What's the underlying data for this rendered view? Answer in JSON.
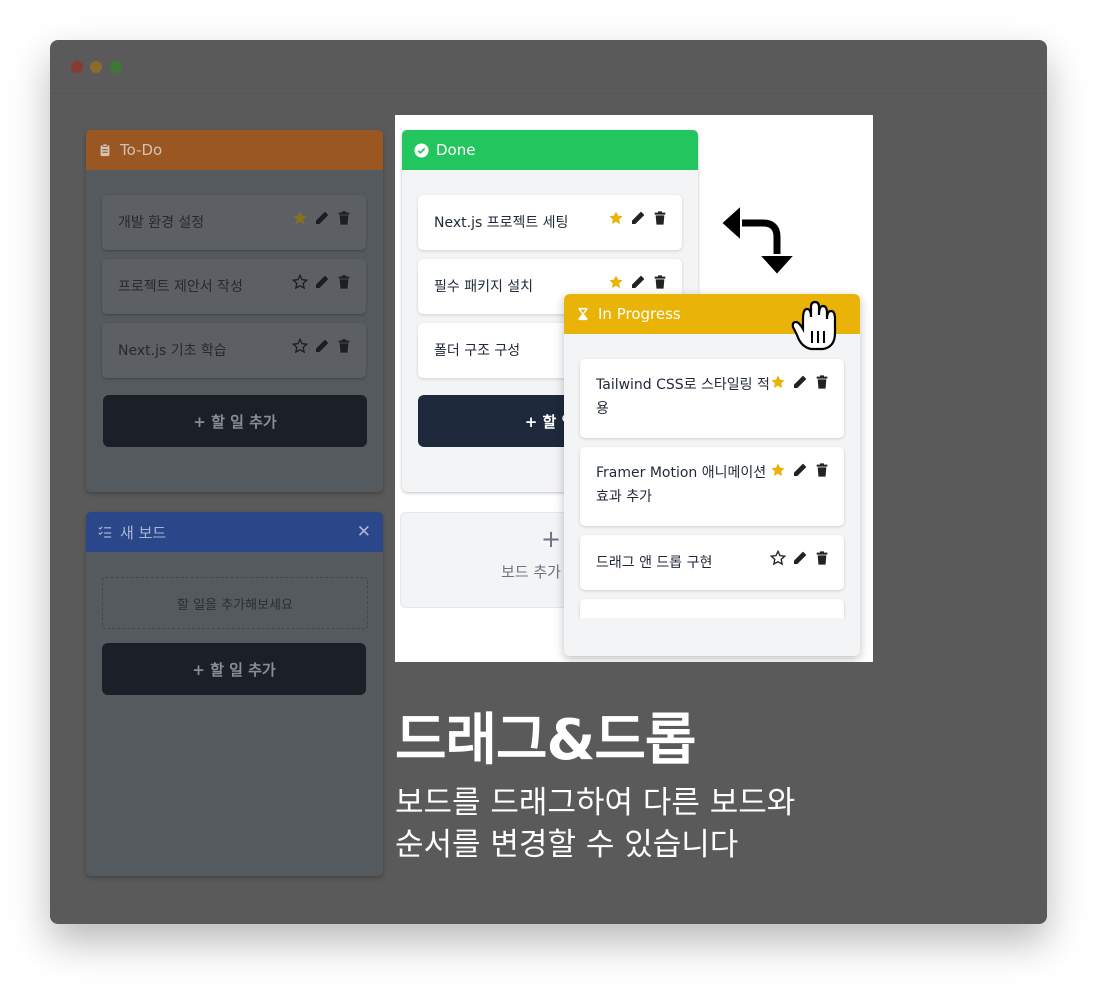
{
  "window": {
    "controls": [
      "close",
      "minimize",
      "maximize"
    ]
  },
  "background_boards": {
    "todo": {
      "title": "To-Do",
      "color": "#b8651f",
      "cards": [
        {
          "text": "개발 환경 설정",
          "starred": true
        },
        {
          "text": "프로젝트 제안서 작성",
          "starred": false
        },
        {
          "text": "Next.js 기초 학습",
          "starred": false
        }
      ],
      "add_label": "+ 할 일 추가"
    },
    "new_board": {
      "title": "새 보드",
      "color": "#2a4a9c",
      "empty_text": "할 일을 추가해보세요",
      "add_label": "+ 할 일 추가",
      "close_label": "✕"
    }
  },
  "overlay": {
    "done_board": {
      "title": "Done",
      "color": "#22c55e",
      "cards": [
        {
          "text": "Next.js 프로젝트 세팅",
          "starred": true
        },
        {
          "text": "필수 패키지 설치",
          "starred": true
        },
        {
          "text": "폴더 구조 구성",
          "starred": false
        }
      ],
      "add_label": "+ 할 일",
      "add_board_plus": "+",
      "add_board_label": "보드 추가"
    },
    "in_progress_board": {
      "title": "In Progress",
      "color": "#eab308",
      "cards": [
        {
          "text": "Tailwind CSS로 스타일링 적용",
          "starred": true
        },
        {
          "text": "Framer Motion 애니메이션 효과 추가",
          "starred": true
        },
        {
          "text": "드래그 앤 드롭 구현",
          "starred": false
        }
      ]
    },
    "swap_arrow_icon": "curved-swap-arrow",
    "cursor_icon": "grab-hand"
  },
  "caption": {
    "title": "드래그&드롭",
    "line1": "보드를 드래그하여 다른 보드와",
    "line2": "순서를 변경할 수 있습니다"
  },
  "colors": {
    "star": "#eab308",
    "dark_button": "#1e293b",
    "window_bg": "#5a5a5a"
  }
}
